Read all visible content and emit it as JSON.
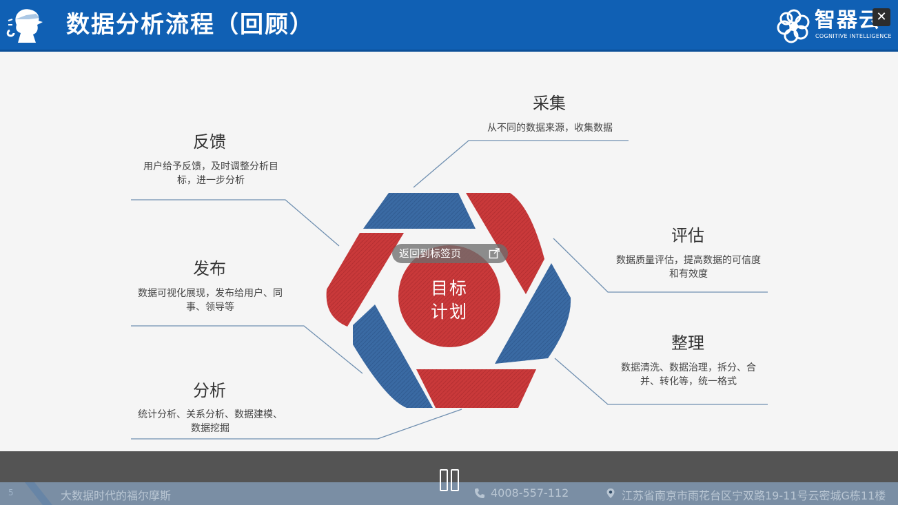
{
  "header": {
    "title": "数据分析流程（回顾）",
    "brand_name": "智器云",
    "brand_sub": "COGNITIVE INTELLIGENCE",
    "close_label": "✕"
  },
  "diagram": {
    "center_text": "目标\n计划",
    "steps": [
      {
        "title": "采集",
        "desc": "从不同的数据来源，收集数据"
      },
      {
        "title": "评估",
        "desc": "数据质量评估，提高数据的可信度和有效度"
      },
      {
        "title": "整理",
        "desc": "数据清洗、数据治理，拆分、合并、转化等，统一格式"
      },
      {
        "title": "分析",
        "desc": "统计分析、关系分析、数据建模、数据挖掘"
      },
      {
        "title": "发布",
        "desc": "数据可视化展现，发布给用户、同事、领导等"
      },
      {
        "title": "反馈",
        "desc": "用户给予反馈，及时调整分析目标，进一步分析"
      }
    ],
    "colors": {
      "red": "#c9393a",
      "blue": "#3a6aa3",
      "line": "#6f8fb0"
    }
  },
  "overlay": {
    "label": "返回到标签页"
  },
  "footer": {
    "page_number": "5",
    "slogan": "大数据时代的福尔摩斯",
    "phone": "4008-557-112",
    "address": "江苏省南京市雨花台区宁双路19-11号云密城G栋11楼"
  },
  "colors": {
    "header_blue": "#1060b4",
    "player_bg": "#464646"
  }
}
